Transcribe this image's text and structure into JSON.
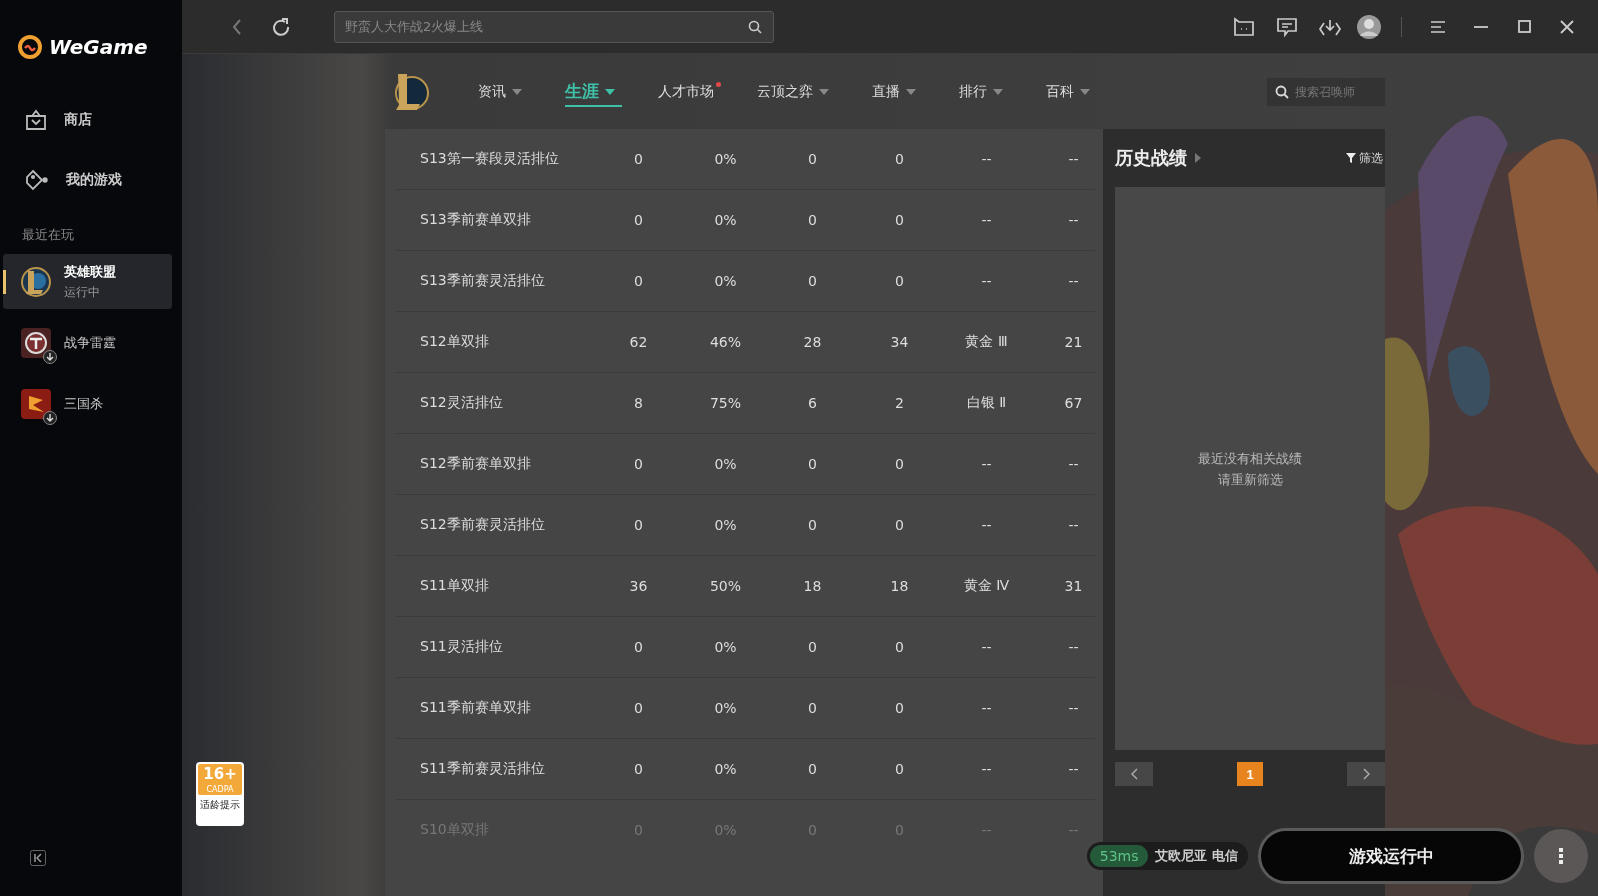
{
  "sidebar": {
    "brand": "WeGame",
    "nav": [
      {
        "kind": "store",
        "label": "商店"
      },
      {
        "kind": "games",
        "label": "我的游戏"
      }
    ],
    "section_title": "最近在玩",
    "games": [
      {
        "kind": "lol",
        "name": "英雄联盟",
        "status": "运行中",
        "selected": true,
        "download": false
      },
      {
        "kind": "thunder",
        "name": "战争雷霆",
        "selected": false,
        "download": true
      },
      {
        "kind": "sgs",
        "name": "三国杀",
        "selected": false,
        "download": true
      }
    ]
  },
  "topbar": {
    "search": {
      "placeholder": "野蛮人大作战2火爆上线"
    }
  },
  "nav": {
    "tabs": [
      {
        "label": "资讯",
        "selected": false,
        "caret": true,
        "dot": false
      },
      {
        "label": "生涯",
        "selected": true,
        "caret": true,
        "dot": false
      },
      {
        "label": "人才市场",
        "selected": false,
        "caret": false,
        "dot": true
      },
      {
        "label": "云顶之弈",
        "selected": false,
        "caret": true,
        "dot": false
      },
      {
        "label": "直播",
        "selected": false,
        "caret": true,
        "dot": false
      },
      {
        "label": "排行",
        "selected": false,
        "caret": true,
        "dot": false
      },
      {
        "label": "百科",
        "selected": false,
        "caret": true,
        "dot": false
      }
    ],
    "summoner_search": {
      "placeholder": "搜索召唤师"
    }
  },
  "table": {
    "rows": [
      {
        "faded": false,
        "cells": [
          "S13第一赛段灵活排位",
          "0",
          "0%",
          "0",
          "0",
          "--",
          "--"
        ]
      },
      {
        "faded": false,
        "cells": [
          "S13季前赛单双排",
          "0",
          "0%",
          "0",
          "0",
          "--",
          "--"
        ]
      },
      {
        "faded": false,
        "cells": [
          "S13季前赛灵活排位",
          "0",
          "0%",
          "0",
          "0",
          "--",
          "--"
        ]
      },
      {
        "faded": false,
        "cells": [
          "S12单双排",
          "62",
          "46%",
          "28",
          "34",
          "黄金 Ⅲ",
          "21"
        ]
      },
      {
        "faded": false,
        "cells": [
          "S12灵活排位",
          "8",
          "75%",
          "6",
          "2",
          "白银 Ⅱ",
          "67"
        ]
      },
      {
        "faded": false,
        "cells": [
          "S12季前赛单双排",
          "0",
          "0%",
          "0",
          "0",
          "--",
          "--"
        ]
      },
      {
        "faded": false,
        "cells": [
          "S12季前赛灵活排位",
          "0",
          "0%",
          "0",
          "0",
          "--",
          "--"
        ]
      },
      {
        "faded": false,
        "cells": [
          "S11单双排",
          "36",
          "50%",
          "18",
          "18",
          "黄金 Ⅳ",
          "31"
        ]
      },
      {
        "faded": false,
        "cells": [
          "S11灵活排位",
          "0",
          "0%",
          "0",
          "0",
          "--",
          "--"
        ]
      },
      {
        "faded": false,
        "cells": [
          "S11季前赛单双排",
          "0",
          "0%",
          "0",
          "0",
          "--",
          "--"
        ]
      },
      {
        "faded": false,
        "cells": [
          "S11季前赛灵活排位",
          "0",
          "0%",
          "0",
          "0",
          "--",
          "--"
        ]
      },
      {
        "faded": true,
        "cells": [
          "S10单双排",
          "0",
          "0%",
          "0",
          "0",
          "--",
          "--"
        ]
      }
    ]
  },
  "history": {
    "title": "历史战绩",
    "filter": "筛选",
    "empty_lines": [
      "最近没有相关战绩",
      "请重新筛选"
    ],
    "pages": [
      {
        "label": "1",
        "selected": true
      }
    ]
  },
  "age_badge": {
    "rating": "16+",
    "org": "CADPA",
    "caption": "适龄提示"
  },
  "launch": {
    "ping": "53ms",
    "server": "艾欧尼亚 电信",
    "button": "游戏运行中"
  }
}
